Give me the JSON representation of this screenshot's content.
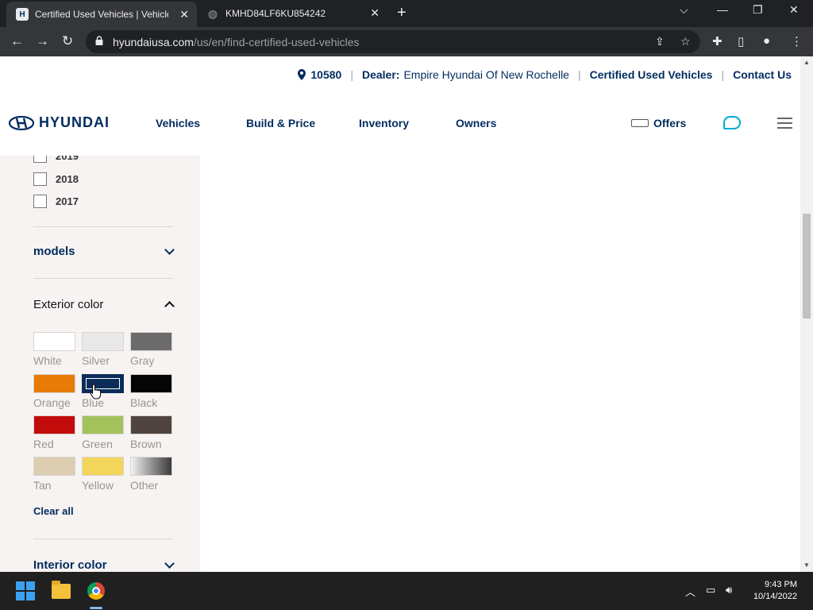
{
  "browser": {
    "tabs": [
      {
        "title": "Certified Used Vehicles | Vehicle",
        "favicon": "hyundai-favicon"
      },
      {
        "title": "KMHD84LF6KU854242",
        "favicon": "globe-icon"
      }
    ],
    "url_host": "hyundaiusa.com",
    "url_path": "/us/en/find-certified-used-vehicles"
  },
  "utility_bar": {
    "zip": "10580",
    "dealer_label": "Dealer:",
    "dealer_name": "Empire Hyundai Of New Rochelle",
    "certified_link": "Certified Used Vehicles",
    "contact_link": "Contact Us"
  },
  "main_nav": {
    "logo_text": "HYUNDAI",
    "links": [
      "Vehicles",
      "Build & Price",
      "Inventory",
      "Owners"
    ],
    "offers": "Offers"
  },
  "filters": {
    "years": [
      "2019",
      "2018",
      "2017"
    ],
    "models_title": "models",
    "exterior_title": "Exterior color",
    "colors": [
      {
        "name": "White",
        "hex": "#ffffff",
        "selected": false
      },
      {
        "name": "Silver",
        "hex": "#e8e8e8",
        "selected": false
      },
      {
        "name": "Gray",
        "hex": "#6b6b6b",
        "selected": false
      },
      {
        "name": "Orange",
        "hex": "#e87a06",
        "selected": false
      },
      {
        "name": "Blue",
        "hex": "#0c2d5a",
        "selected": true
      },
      {
        "name": "Black",
        "hex": "#050505",
        "selected": false
      },
      {
        "name": "Red",
        "hex": "#c20b0b",
        "selected": false
      },
      {
        "name": "Green",
        "hex": "#a4c25c",
        "selected": false
      },
      {
        "name": "Brown",
        "hex": "#504440",
        "selected": false
      },
      {
        "name": "Tan",
        "hex": "#dccdb0",
        "selected": false
      },
      {
        "name": "Yellow",
        "hex": "#f3d55c",
        "selected": false
      },
      {
        "name": "Other",
        "hex": "gradient",
        "selected": false
      }
    ],
    "clear_all": "Clear all",
    "interior_title": "Interior color"
  },
  "taskbar": {
    "time": "9:43 PM",
    "date": "10/14/2022"
  }
}
